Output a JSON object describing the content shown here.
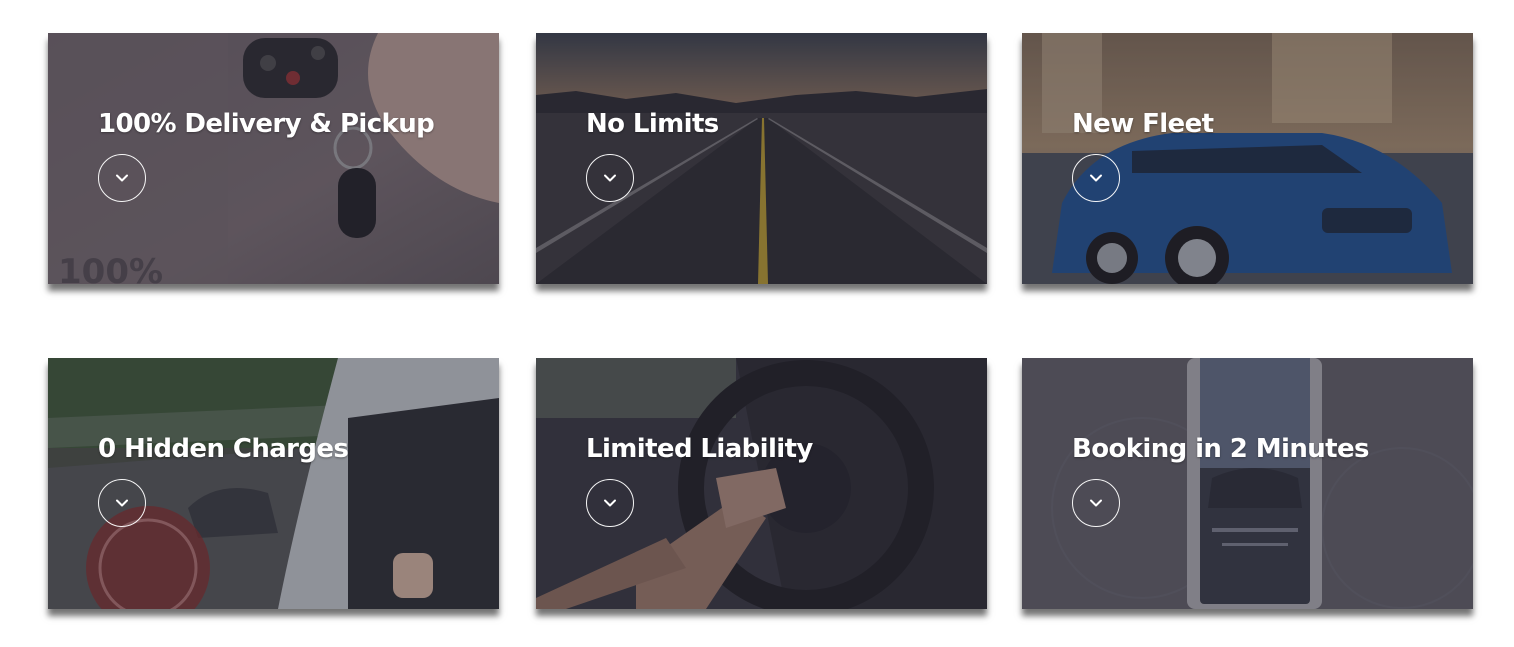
{
  "features": [
    {
      "title": "100% Delivery & Pickup",
      "icon": "chevron-down-icon"
    },
    {
      "title": "No Limits",
      "icon": "chevron-down-icon"
    },
    {
      "title": "New Fleet",
      "icon": "chevron-down-icon"
    },
    {
      "title": "0 Hidden Charges",
      "icon": "chevron-down-icon"
    },
    {
      "title": "Limited Liability",
      "icon": "chevron-down-icon"
    },
    {
      "title": "Booking in 2 Minutes",
      "icon": "chevron-down-icon"
    }
  ],
  "colors": {
    "overlay": "#28263273",
    "title_text": "#ffffff",
    "page_background": "#ffffff"
  }
}
